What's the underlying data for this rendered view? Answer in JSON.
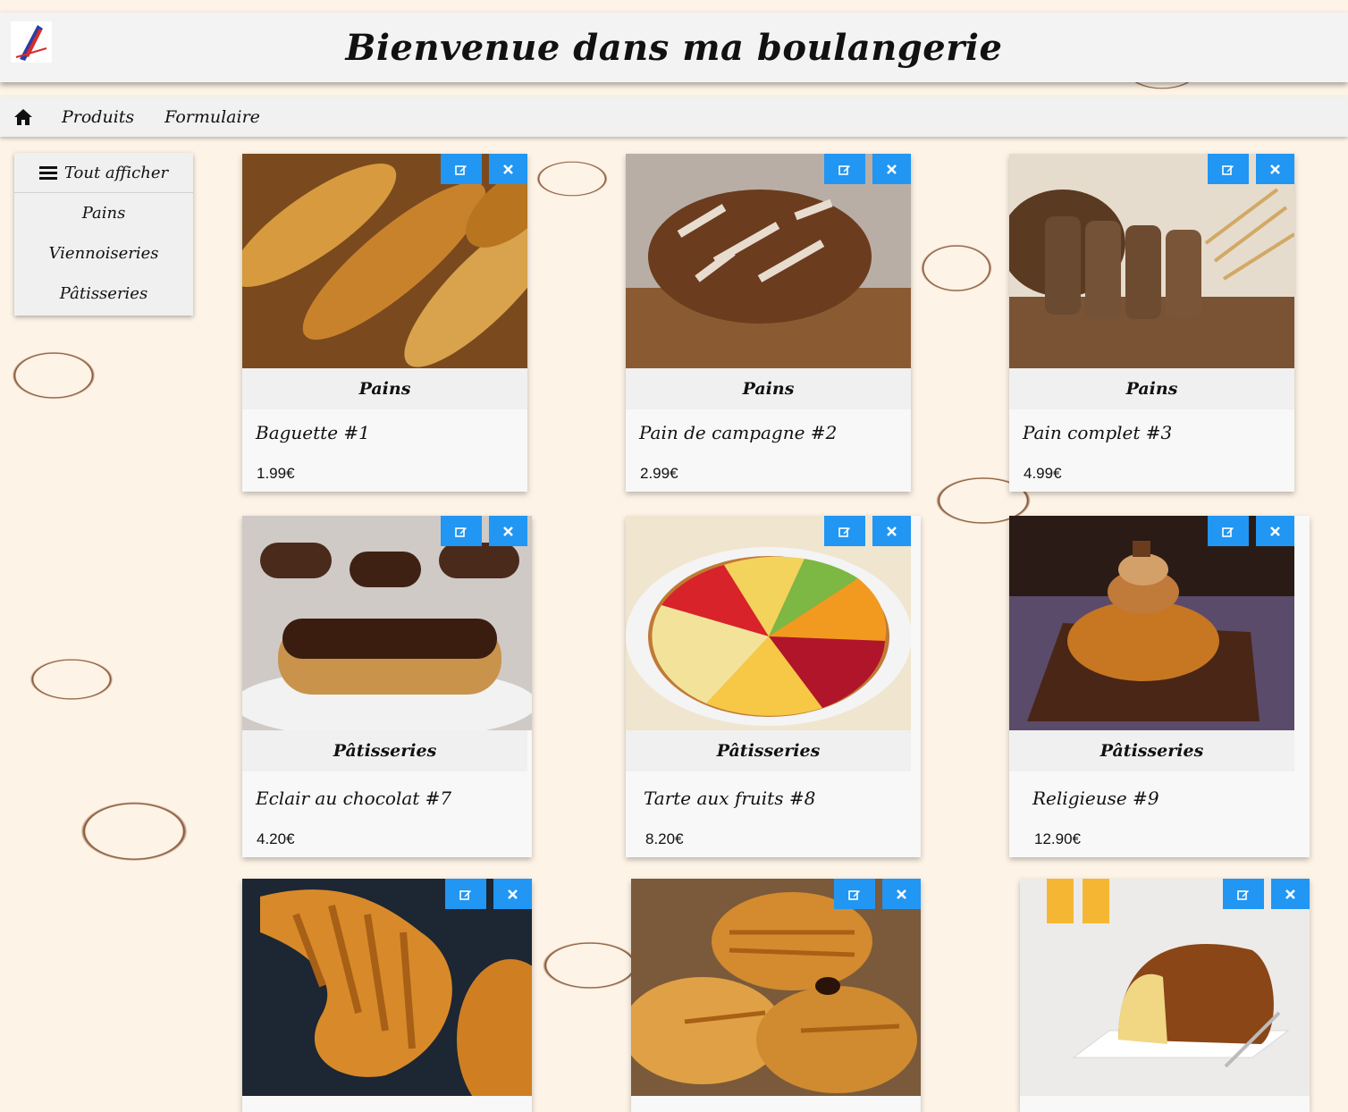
{
  "header": {
    "title": "Bienvenue dans ma boulangerie"
  },
  "navbar": {
    "home_icon": "home-icon",
    "links": [
      "Produits",
      "Formulaire"
    ]
  },
  "sidebar": {
    "items": [
      "Tout afficher",
      "Pains",
      "Viennoiseries",
      "Pâtisseries"
    ]
  },
  "colors": {
    "accent": "#2196f3",
    "background": "#fdf3e6",
    "sketch": "#7a4522"
  },
  "products": [
    {
      "category": "Pains",
      "name": "Baguette #1",
      "price": "1.99€",
      "image": "baguettes"
    },
    {
      "category": "Pains",
      "name": "Pain de campagne #2",
      "price": "2.99€",
      "image": "country-loaf"
    },
    {
      "category": "Pains",
      "name": "Pain complet #3",
      "price": "4.99€",
      "image": "wholegrain-bread"
    },
    {
      "category": "Pâtisseries",
      "name": "Eclair au chocolat #7",
      "price": "4.20€",
      "image": "chocolate-eclair"
    },
    {
      "category": "Pâtisseries",
      "name": "Tarte aux fruits #8",
      "price": "8.20€",
      "image": "fruit-tart"
    },
    {
      "category": "Pâtisseries",
      "name": "Religieuse #9",
      "price": "12.90€",
      "image": "religieuse"
    },
    {
      "category": "",
      "name": "",
      "price": "",
      "image": "croissant"
    },
    {
      "category": "",
      "name": "",
      "price": "",
      "image": "pain-au-chocolat"
    },
    {
      "category": "",
      "name": "",
      "price": "",
      "image": "brioche"
    }
  ]
}
